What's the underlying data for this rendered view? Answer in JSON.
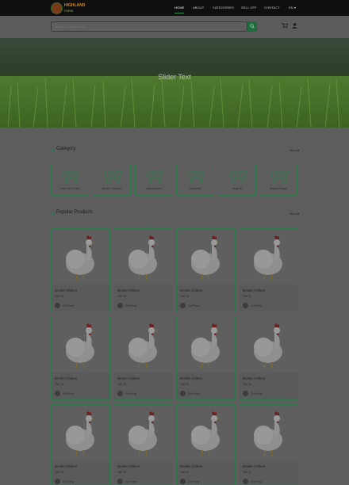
{
  "brand": {
    "line1": "HIGHLAND",
    "line2": "FARM"
  },
  "nav": {
    "items": [
      {
        "label": "HOME",
        "active": true
      },
      {
        "label": "ABOUT",
        "active": false
      },
      {
        "label": "CATEGORIES",
        "active": false
      },
      {
        "label": "SELL OFF",
        "active": false
      },
      {
        "label": "CONTACT",
        "active": false
      },
      {
        "label": "EN",
        "active": false
      }
    ]
  },
  "search": {
    "placeholder": "Search products here"
  },
  "icons": {
    "search": "search-icon",
    "cart": "cart-icon",
    "user": "user-icon"
  },
  "hero": {
    "text": "Slider Text"
  },
  "category_section": {
    "title": "Category",
    "view_all": "View All",
    "items": [
      {
        "label": "Gut Farm Cow"
      },
      {
        "label": "Broiler Chicken"
      },
      {
        "label": "Handpicked"
      },
      {
        "label": "Goat Milk"
      },
      {
        "label": "Organic"
      },
      {
        "label": "Black Bengal"
      }
    ]
  },
  "popular_section": {
    "title": "Popular Products",
    "view_all": "View All",
    "products": [
      {
        "name": "Broiler Chiken",
        "price": "780 Tk",
        "seller": "Gul Pinny"
      },
      {
        "name": "Broiler Chiken",
        "price": "780 Tk",
        "seller": "Gul Pinny"
      },
      {
        "name": "Broiler Chiken",
        "price": "780 Tk",
        "seller": "Gul Pinny"
      },
      {
        "name": "Broiler Chiken",
        "price": "780 Tk",
        "seller": "Gul Pinny"
      },
      {
        "name": "Broiler Chiken",
        "price": "780 Tk",
        "seller": "Gul Pinny"
      },
      {
        "name": "Broiler Chiken",
        "price": "780 Tk",
        "seller": "Gul Pinny"
      },
      {
        "name": "Broiler Chiken",
        "price": "780 Tk",
        "seller": "Gul Pinny"
      },
      {
        "name": "Broiler Chiken",
        "price": "780 Tk",
        "seller": "Gul Pinny"
      },
      {
        "name": "Broiler Chiken",
        "price": "780 Tk",
        "seller": "Gul Pinny"
      },
      {
        "name": "Broiler Chiken",
        "price": "780 Tk",
        "seller": "Gul Pinny"
      },
      {
        "name": "Broiler Chiken",
        "price": "780 Tk",
        "seller": "Gul Pinny"
      },
      {
        "name": "Broiler Chiken",
        "price": "780 Tk",
        "seller": "Gul Pinny"
      }
    ]
  },
  "colors": {
    "accent": "#2f7a4c",
    "nav_bg": "#0f0f0f",
    "page_bg": "#5d5d5d"
  }
}
